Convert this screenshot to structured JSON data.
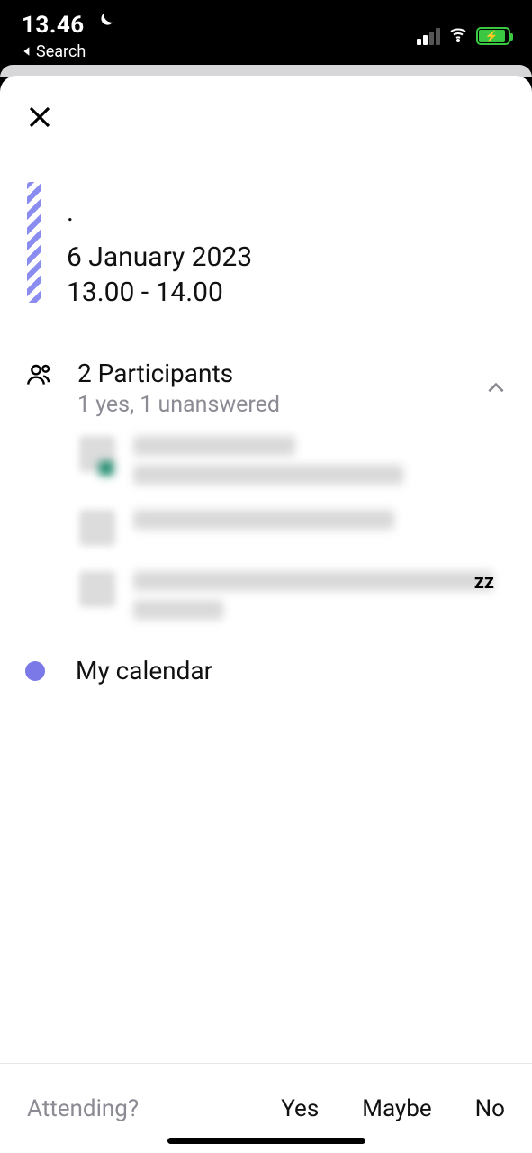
{
  "status_bar": {
    "time": "13.46",
    "back_label": "Search"
  },
  "event": {
    "title": ".",
    "date": "6 January 2023",
    "time": "13.00 - 14.00"
  },
  "participants": {
    "title": "2 Participants",
    "summary": "1 yes, 1 unanswered",
    "badge": "zz"
  },
  "calendar": {
    "label": "My calendar"
  },
  "rsvp": {
    "prompt": "Attending?",
    "yes": "Yes",
    "maybe": "Maybe",
    "no": "No"
  }
}
